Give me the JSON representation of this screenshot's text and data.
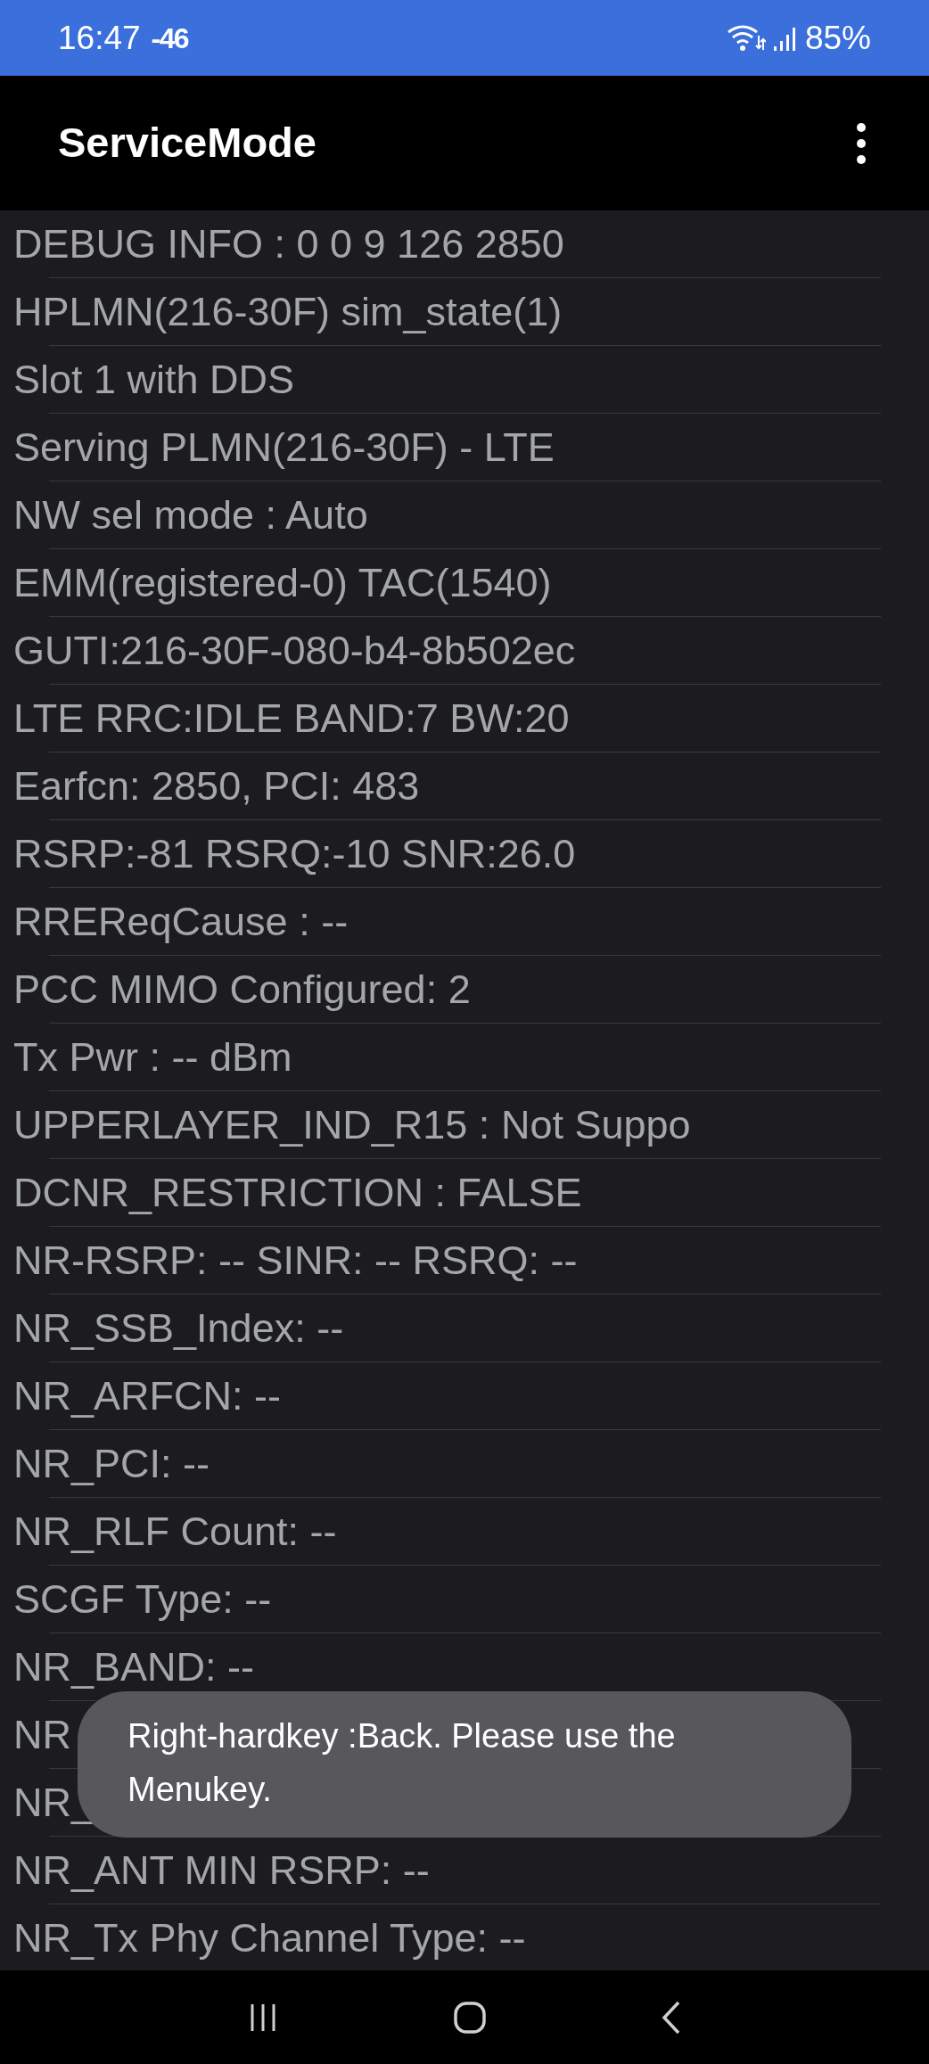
{
  "status_bar": {
    "time": "16:47",
    "signal_reading": "-46",
    "battery": "85%"
  },
  "app_bar": {
    "title": "ServiceMode"
  },
  "rows": [
    "DEBUG INFO : 0 0 9 126 2850",
    "HPLMN(216-30F) sim_state(1)",
    "Slot 1 with DDS",
    "Serving PLMN(216-30F) - LTE",
    "NW sel mode : Auto",
    "EMM(registered-0) TAC(1540)",
    "GUTI:216-30F-080-b4-8b502ec",
    "LTE RRC:IDLE BAND:7 BW:20",
    "Earfcn: 2850, PCI: 483",
    "RSRP:-81 RSRQ:-10 SNR:26.0",
    "RREReqCause : --",
    "PCC MIMO Configured: 2",
    "Tx Pwr : -- dBm",
    "UPPERLAYER_IND_R15 : Not Suppo",
    "DCNR_RESTRICTION : FALSE",
    "NR-RSRP: -- SINR: -- RSRQ: --",
    "NR_SSB_Index: --",
    "NR_ARFCN: --",
    "NR_PCI: --",
    "NR_RLF Count: --",
    "SCGF Type: --",
    "NR_BAND: --",
    "NR",
    "NR_",
    "NR_ANT MIN RSRP: --",
    "NR_Tx Phy Channel Type: --"
  ],
  "toast": {
    "message": "Right-hardkey :Back.   Please use the Menukey."
  }
}
